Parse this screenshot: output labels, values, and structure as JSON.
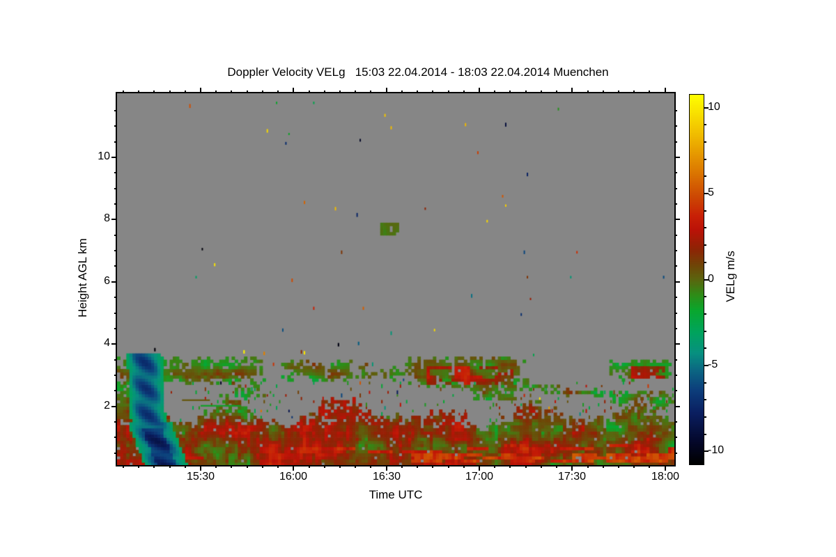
{
  "chart_data": {
    "type": "heatmap",
    "title": "Doppler Velocity VELg   15:03 22.04.2014 - 18:03 22.04.2014 Muenchen",
    "variable": "Doppler Velocity VELg",
    "site": "Muenchen",
    "time_start": "15:03 22.04.2014",
    "time_end": "18:03 22.04.2014",
    "axes": {
      "x": {
        "title": "Time UTC",
        "duration_min": 180,
        "ticks": [
          {
            "min": 27,
            "label": "15:30"
          },
          {
            "min": 57,
            "label": "16:00"
          },
          {
            "min": 87,
            "label": "16:30"
          },
          {
            "min": 117,
            "label": "17:00"
          },
          {
            "min": 147,
            "label": "17:30"
          },
          {
            "min": 177,
            "label": "18:00"
          }
        ],
        "minor_step_min": 5
      },
      "y": {
        "title": "Height AGL km",
        "range_km": [
          0.11,
          12.06
        ],
        "ticks": [
          {
            "km": 2,
            "label": "2"
          },
          {
            "km": 4,
            "label": "4"
          },
          {
            "km": 6,
            "label": "6"
          },
          {
            "km": 8,
            "label": "8"
          },
          {
            "km": 10,
            "label": "10"
          }
        ],
        "minor_step_km": 0.5
      }
    },
    "colorbar": {
      "title": "VELg m/s",
      "range": [
        -10.75,
        10.75
      ],
      "ticks": [
        {
          "v": 10,
          "label": "10"
        },
        {
          "v": 5,
          "label": "5"
        },
        {
          "v": 0,
          "label": "0"
        },
        {
          "v": -5,
          "label": "-5"
        },
        {
          "v": -10,
          "label": "-10"
        }
      ],
      "minor_step": 1
    },
    "colors": {
      "background": "#ffffff",
      "nodata_gray": "#868686",
      "frame": "#000000",
      "colormap_stops": [
        [
          -10.75,
          "#000000"
        ],
        [
          -9.4,
          "#04082c"
        ],
        [
          -7.8,
          "#0a1e60"
        ],
        [
          -6.4,
          "#0c3f7c"
        ],
        [
          -5.3,
          "#0b6682"
        ],
        [
          -4.3,
          "#079080"
        ],
        [
          -3.1,
          "#00a35e"
        ],
        [
          -1.8,
          "#09a72e"
        ],
        [
          -0.9,
          "#2f8c17"
        ],
        [
          0.0,
          "#5b650e"
        ],
        [
          0.8,
          "#6f4607"
        ],
        [
          1.8,
          "#8f2305"
        ],
        [
          2.9,
          "#bb1207"
        ],
        [
          3.7,
          "#c82006"
        ],
        [
          4.8,
          "#cc4703"
        ],
        [
          6.4,
          "#dd7c01"
        ],
        [
          8.4,
          "#f0bb00"
        ],
        [
          10.75,
          "#ffff00"
        ]
      ]
    },
    "field": {
      "seed": 20140422,
      "cell": {
        "minutes": 1,
        "km": 0.1
      },
      "bl": {
        "top_base": 1.85,
        "top_sin_amp": 0.32,
        "top_noise_amp": 0.5,
        "left_raise_until": 6,
        "left_raise_rate": 0.09,
        "dip_t0": 95,
        "dip_t1": 120,
        "dip": 0.2,
        "fill_low": 0.96,
        "fill_top": 0.55,
        "v_base": -1.5,
        "v_noise": 4.6,
        "v_jitter": 2.8,
        "v_km_grad_a": 0.7,
        "v_km_grad_b": 0.55
      },
      "plume": {
        "t0": 4,
        "t1": 24,
        "km_top": 3.66,
        "hw": 5.6,
        "widen_below_km": 1.5,
        "widen": 1.25
      },
      "cloud_segments": [
        {
          "t0": 0,
          "t1": 47,
          "km0": 2.78,
          "km1": 3.58,
          "fill": 0.95
        },
        {
          "t0": 0,
          "t1": 13,
          "km0": 2.3,
          "km1": 2.82,
          "fill": 0.8
        },
        {
          "t0": 36,
          "t1": 47,
          "km0": 2.25,
          "km1": 2.8,
          "fill": 0.5
        },
        {
          "t0": 53,
          "t1": 80,
          "km0": 2.85,
          "km1": 3.45,
          "fill": 0.88
        },
        {
          "t0": 80,
          "t1": 93,
          "km0": 2.9,
          "km1": 3.3,
          "fill": 0.3
        },
        {
          "t0": 93,
          "t1": 131,
          "km0": 2.7,
          "km1": 3.55,
          "fill": 0.95,
          "core": [
            100,
            127,
            2.75,
            3.3
          ]
        },
        {
          "t0": 112,
          "t1": 131,
          "km0": 2.2,
          "km1": 2.75,
          "fill": 0.7
        },
        {
          "type": "line",
          "t0": 131,
          "t1": 160,
          "km_a": 2.72,
          "km_b": 2.3,
          "half": 0.12,
          "fill": 0.85
        },
        {
          "t0": 159,
          "t1": 180,
          "km0": 2.85,
          "km1": 3.5,
          "fill": 0.93,
          "core": [
            166,
            176,
            2.9,
            3.25
          ]
        },
        {
          "t0": 159,
          "t1": 180,
          "km0": 1.9,
          "km1": 2.5,
          "fill": 0.85
        }
      ],
      "streaks": [
        {
          "t0": 95,
          "t1": 180,
          "km0": 0.25,
          "km1": 0.45,
          "v": 4.4,
          "p": 0.6
        },
        {
          "t0": 55,
          "t1": 180,
          "km0": 0.5,
          "km1": 0.65,
          "v": 3.6,
          "p": 0.42
        },
        {
          "t0": 125,
          "t1": 180,
          "km0": 0.72,
          "km1": 0.85,
          "v": 3.2,
          "p": 0.38
        },
        {
          "t0": 20,
          "t1": 95,
          "km0": 0.28,
          "km1": 0.4,
          "v": 3.0,
          "p": 0.3
        }
      ],
      "blob": {
        "t0": 85,
        "t1": 90,
        "km0": 7.5,
        "km1": 7.9,
        "v": -0.2
      },
      "dashes": [
        {
          "t0": 21,
          "t1": 30,
          "km": 2.2,
          "v": 0.4
        },
        {
          "t0": 27,
          "t1": 40,
          "km": 2.02,
          "v": -1.6
        }
      ],
      "features": [
        {
          "t": 12.2,
          "km": 3.82,
          "v": -10.5
        },
        {
          "t": 41,
          "km": 3.75,
          "v": 10.2
        },
        {
          "t": 47.5,
          "km": 3.7,
          "v": 6.5
        },
        {
          "t": 71.5,
          "km": 3.98,
          "v": -10.2
        },
        {
          "t": 78,
          "km": 4.02,
          "v": -5.5
        },
        {
          "t": 60.5,
          "km": 3.72,
          "v": 9.8
        }
      ],
      "speckles": {
        "clear_p": 0.0042,
        "gap_p": 0.085,
        "gap_top_km": 2.78,
        "gap_bottom_km": 1.2
      }
    }
  }
}
